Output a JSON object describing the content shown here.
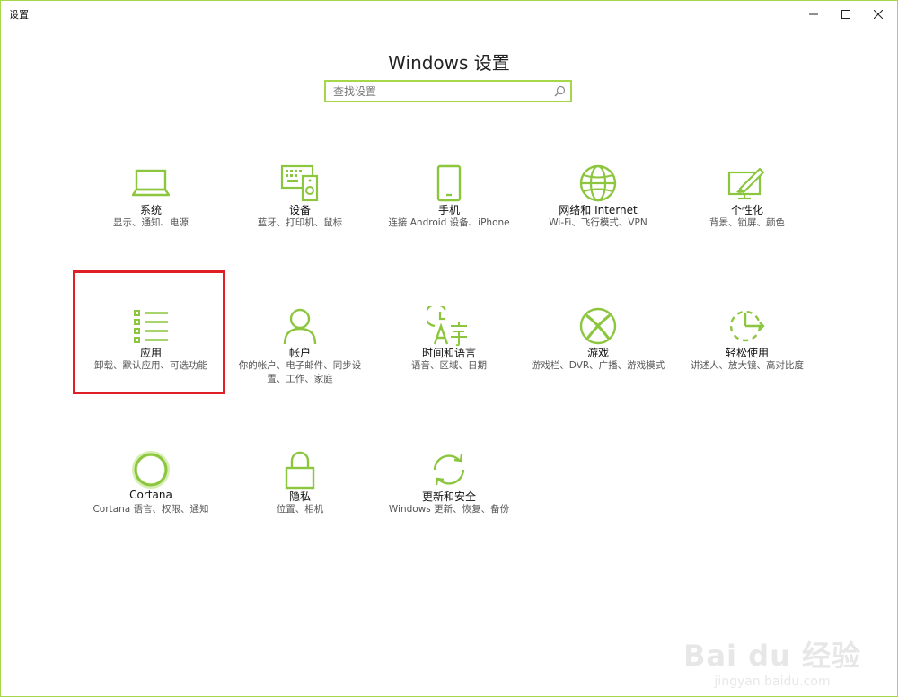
{
  "window": {
    "title": "设置"
  },
  "header": {
    "title": "Windows 设置"
  },
  "search": {
    "placeholder": "查找设置"
  },
  "accent_color": "#8cc63f",
  "highlight_color": "#e01f26",
  "tiles": [
    {
      "name": "系统",
      "desc": "显示、通知、电源",
      "icon": "laptop-icon"
    },
    {
      "name": "设备",
      "desc": "蓝牙、打印机、鼠标",
      "icon": "devices-icon"
    },
    {
      "name": "手机",
      "desc": "连接 Android 设备、iPhone",
      "icon": "phone-icon"
    },
    {
      "name": "网络和 Internet",
      "desc": "Wi-Fi、飞行模式、VPN",
      "icon": "globe-icon"
    },
    {
      "name": "个性化",
      "desc": "背景、锁屏、颜色",
      "icon": "personalize-icon"
    },
    {
      "name": "应用",
      "desc": "卸载、默认应用、可选功能",
      "icon": "apps-list-icon"
    },
    {
      "name": "帐户",
      "desc": "你的帐户、电子邮件、同步设置、工作、家庭",
      "icon": "person-icon"
    },
    {
      "name": "时间和语言",
      "desc": "语音、区域、日期",
      "icon": "time-language-icon"
    },
    {
      "name": "游戏",
      "desc": "游戏栏、DVR、广播、游戏模式",
      "icon": "xbox-icon"
    },
    {
      "name": "轻松使用",
      "desc": "讲述人、放大镜、高对比度",
      "icon": "ease-of-access-icon"
    },
    {
      "name": "Cortana",
      "desc": "Cortana 语言、权限、通知",
      "icon": "cortana-icon"
    },
    {
      "name": "隐私",
      "desc": "位置、相机",
      "icon": "lock-icon"
    },
    {
      "name": "更新和安全",
      "desc": "Windows 更新、恢复、备份",
      "icon": "sync-icon"
    }
  ],
  "watermark": {
    "main": "Bai du 经验",
    "sub": "jingyan.baidu.com"
  }
}
